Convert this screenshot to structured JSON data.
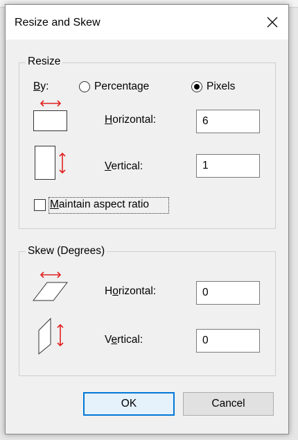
{
  "dialog": {
    "title": "Resize and Skew"
  },
  "resize": {
    "group_label": "Resize",
    "by_label": "By:",
    "by_label_underline": "B",
    "by_label_rest": "y:",
    "options": [
      {
        "label": "Percentage",
        "selected": false
      },
      {
        "label": "Pixels",
        "selected": true
      }
    ],
    "horizontal": {
      "label_u": "H",
      "label_rest": "orizontal:",
      "value": "6"
    },
    "vertical": {
      "label_u": "V",
      "label_rest": "ertical:",
      "value": "1"
    },
    "maintain_aspect": {
      "label_u": "M",
      "label_rest": "aintain aspect ratio",
      "checked": false
    }
  },
  "skew": {
    "group_label": "Skew (Degrees)",
    "horizontal": {
      "label_pre": "H",
      "label_u": "o",
      "label_rest": "rizontal:",
      "value": "0"
    },
    "vertical": {
      "label_pre": "V",
      "label_u": "e",
      "label_rest": "rtical:",
      "value": "0"
    }
  },
  "buttons": {
    "ok": "OK",
    "cancel": "Cancel"
  },
  "colors": {
    "arrow_red": "#e02020",
    "focus_blue": "#0078d7"
  }
}
